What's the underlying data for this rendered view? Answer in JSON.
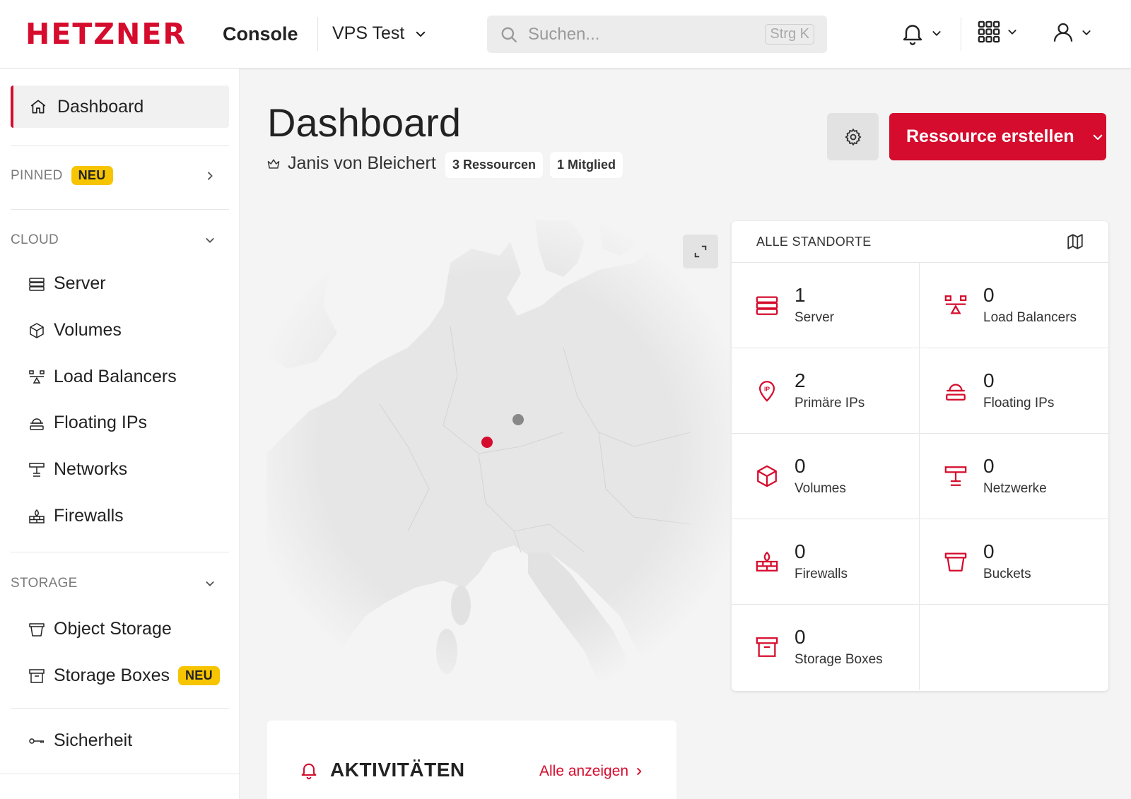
{
  "brand": {
    "logo": "HETZNER",
    "app": "Console"
  },
  "header": {
    "project": "VPS Test",
    "search_placeholder": "Suchen...",
    "search_shortcut": "Strg K"
  },
  "sidebar": {
    "active": "Dashboard",
    "pinned": {
      "label": "PINNED",
      "badge": "NEU"
    },
    "cloud": {
      "label": "CLOUD",
      "items": [
        "Server",
        "Volumes",
        "Load Balancers",
        "Floating IPs",
        "Networks",
        "Firewalls"
      ]
    },
    "storage": {
      "label": "STORAGE",
      "items": [
        "Object Storage",
        "Storage Boxes"
      ],
      "storage_boxes_badge": "NEU"
    },
    "security": "Sicherheit"
  },
  "main": {
    "title": "Dashboard",
    "owner": "Janis von Bleichert",
    "resources_pill": "3 Ressourcen",
    "members_pill": "1 Mitglied",
    "create_button": "Ressource erstellen"
  },
  "locations": {
    "header": "ALLE STANDORTE",
    "stats": [
      {
        "count": "1",
        "label": "Server",
        "icon": "server-icon"
      },
      {
        "count": "0",
        "label": "Load Balancers",
        "icon": "load-balancer-icon"
      },
      {
        "count": "2",
        "label": "Primäre IPs",
        "icon": "primary-ip-icon"
      },
      {
        "count": "0",
        "label": "Floating IPs",
        "icon": "floating-ip-icon"
      },
      {
        "count": "0",
        "label": "Volumes",
        "icon": "volume-icon"
      },
      {
        "count": "0",
        "label": "Netzwerke",
        "icon": "network-icon"
      },
      {
        "count": "0",
        "label": "Firewalls",
        "icon": "firewall-icon"
      },
      {
        "count": "0",
        "label": "Buckets",
        "icon": "bucket-icon"
      },
      {
        "count": "0",
        "label": "Storage Boxes",
        "icon": "storage-box-icon"
      }
    ]
  },
  "activity": {
    "title": "AKTIVITÄTEN",
    "link": "Alle anzeigen"
  },
  "colors": {
    "accent": "#d50c2d",
    "badge": "#f7c400"
  }
}
